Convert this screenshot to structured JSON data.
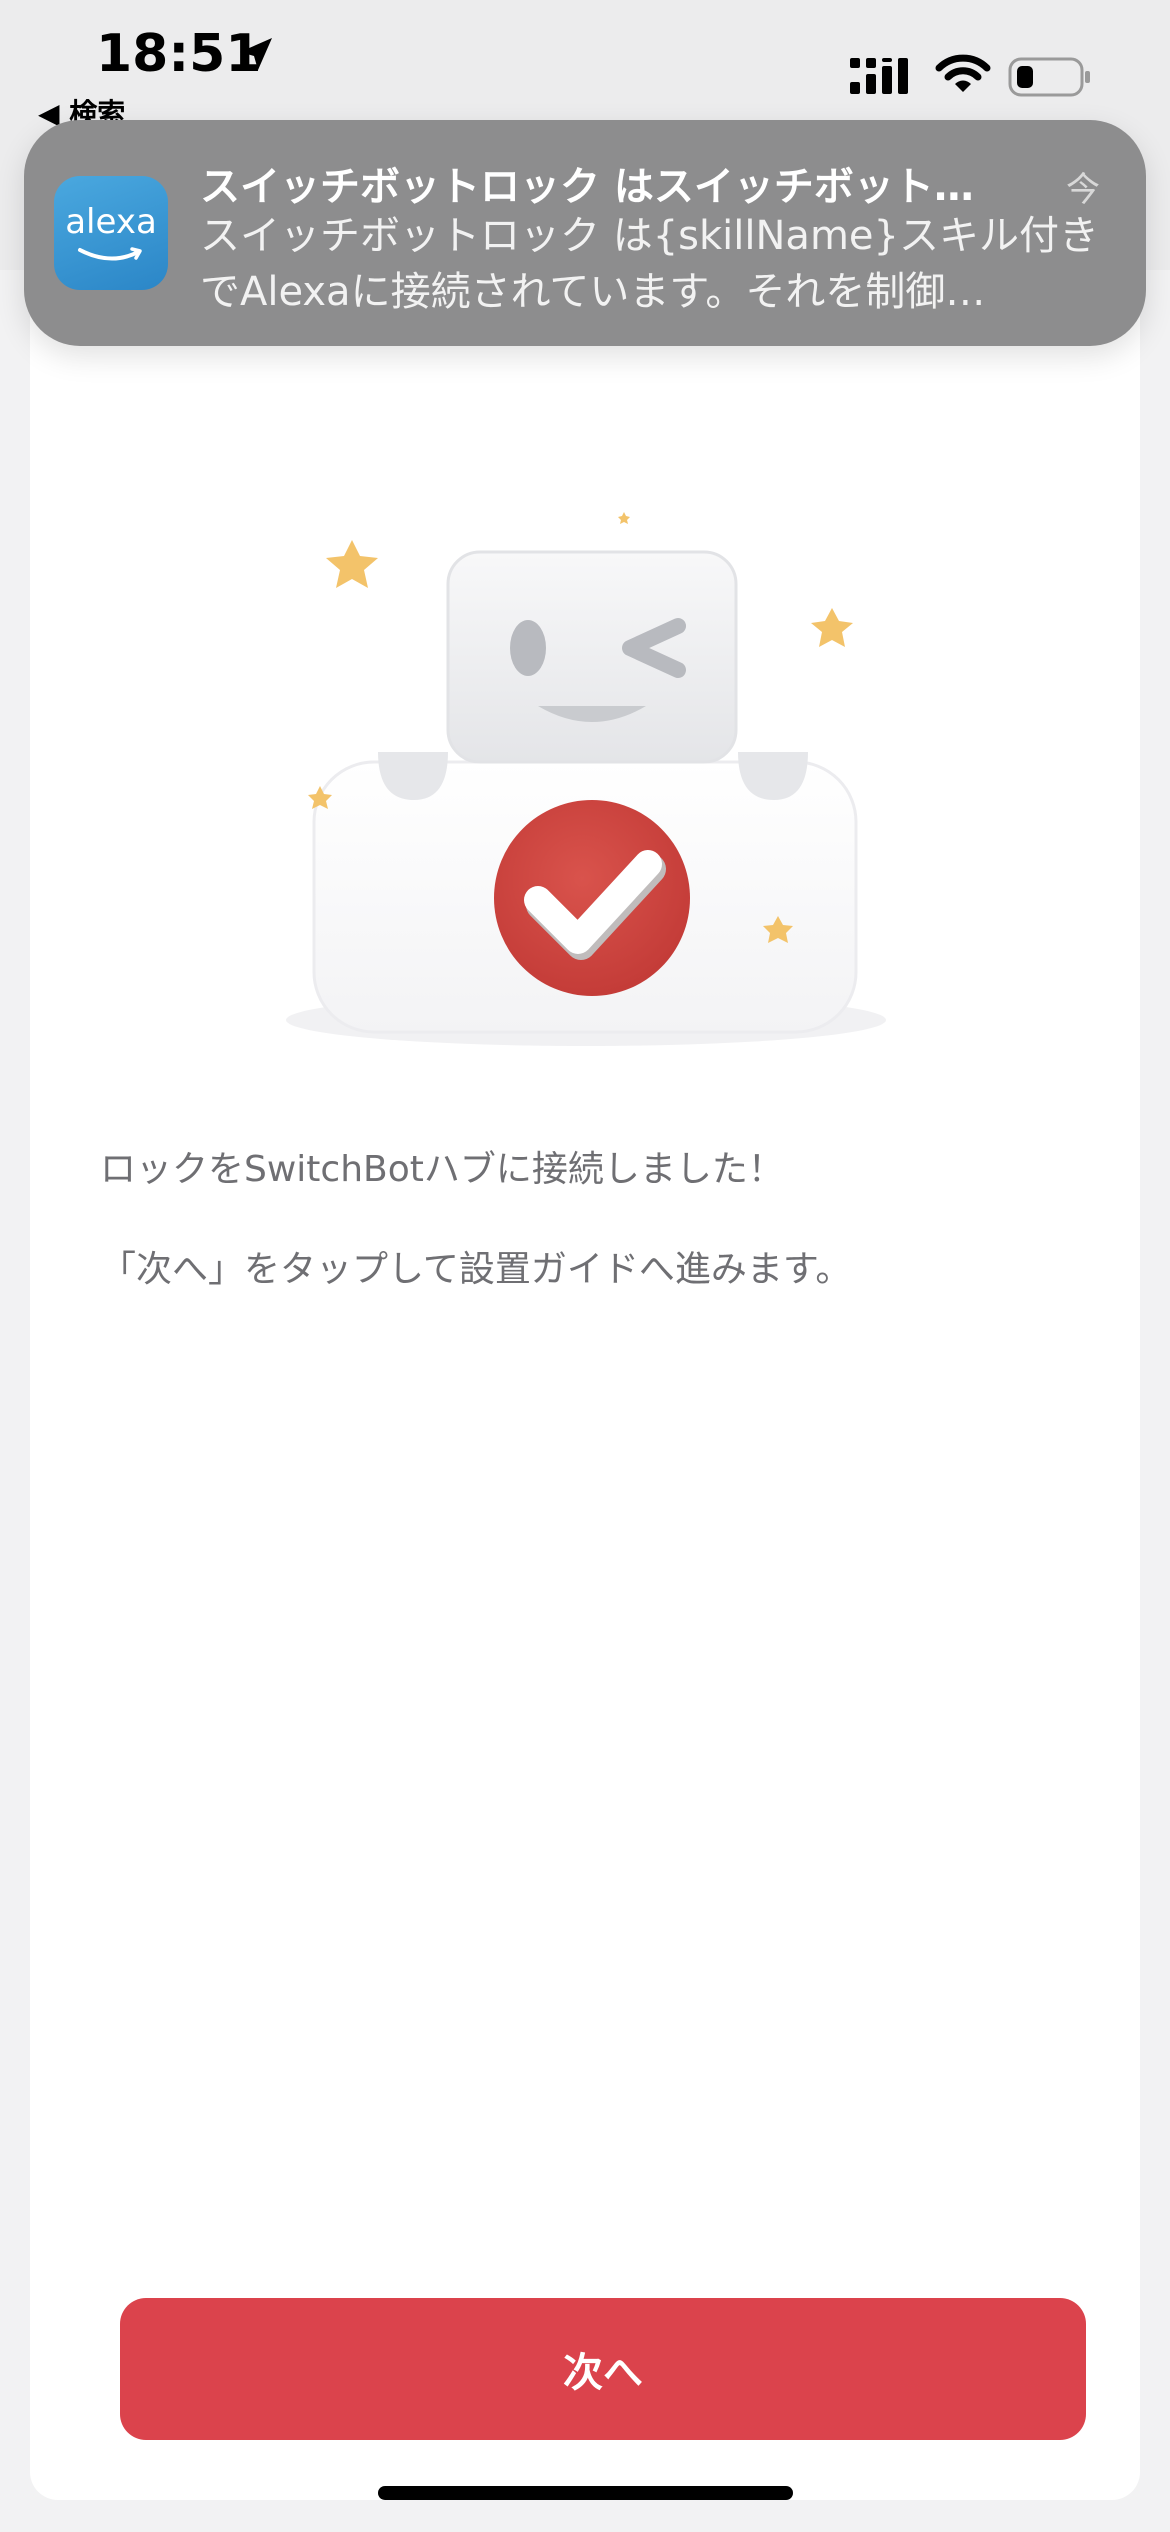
{
  "status_bar": {
    "time": "18:51",
    "back_label": "◀ 検索"
  },
  "notification": {
    "app_icon_label": "alexa",
    "title": "スイッチボットロック はスイッチボット…",
    "body": "スイッチボットロック は{skillName}スキル付きでAlexaに接続されています。それを制御…",
    "time": "今"
  },
  "main": {
    "message_line1": "ロックをSwitchBotハブに接続しました！",
    "message_line2": "「次へ」をタップして設置ガイドへ進みます。",
    "next_button_label": "次へ"
  },
  "colors": {
    "accent": "#db434c",
    "check_badge": "#d14640",
    "star": "#f3c36a"
  },
  "icons": [
    "location-arrow-icon",
    "cellular-signal-icon",
    "wifi-icon",
    "battery-icon",
    "alexa-app-icon",
    "checkmark-icon",
    "star-icon"
  ]
}
